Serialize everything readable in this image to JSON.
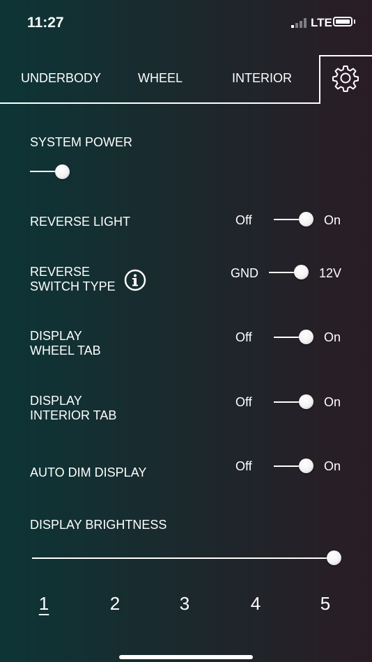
{
  "status_bar": {
    "time": "11:27",
    "network": "LTE"
  },
  "tabs": [
    {
      "label": "UNDERBODY"
    },
    {
      "label": "WHEEL"
    },
    {
      "label": "INTERIOR"
    }
  ],
  "settings": {
    "system_power": {
      "label": "SYSTEM POWER",
      "value": "off"
    },
    "reverse_light": {
      "label": "REVERSE LIGHT",
      "off_label": "Off",
      "on_label": "On",
      "value": "on"
    },
    "reverse_switch_type": {
      "label_line1": "REVERSE",
      "label_line2": "SWITCH TYPE",
      "off_label": "GND",
      "on_label": "12V",
      "value": "12V"
    },
    "display_wheel_tab": {
      "label_line1": "DISPLAY",
      "label_line2": "WHEEL TAB",
      "off_label": "Off",
      "on_label": "On",
      "value": "on"
    },
    "display_interior_tab": {
      "label_line1": "DISPLAY",
      "label_line2": "INTERIOR TAB",
      "off_label": "Off",
      "on_label": "On",
      "value": "on"
    },
    "auto_dim_display": {
      "label": "AUTO DIM DISPLAY",
      "off_label": "Off",
      "on_label": "On",
      "value": "on"
    },
    "display_brightness": {
      "label": "DISPLAY BRIGHTNESS",
      "value": 1.0
    }
  },
  "pages": [
    "1",
    "2",
    "3",
    "4",
    "5"
  ],
  "active_page": "1",
  "colors": {
    "background_start": "#0d3536",
    "background_end": "#2a1c24",
    "foreground": "#ffffff"
  },
  "icons": {
    "settings": "gear-icon",
    "info": "info-icon"
  }
}
